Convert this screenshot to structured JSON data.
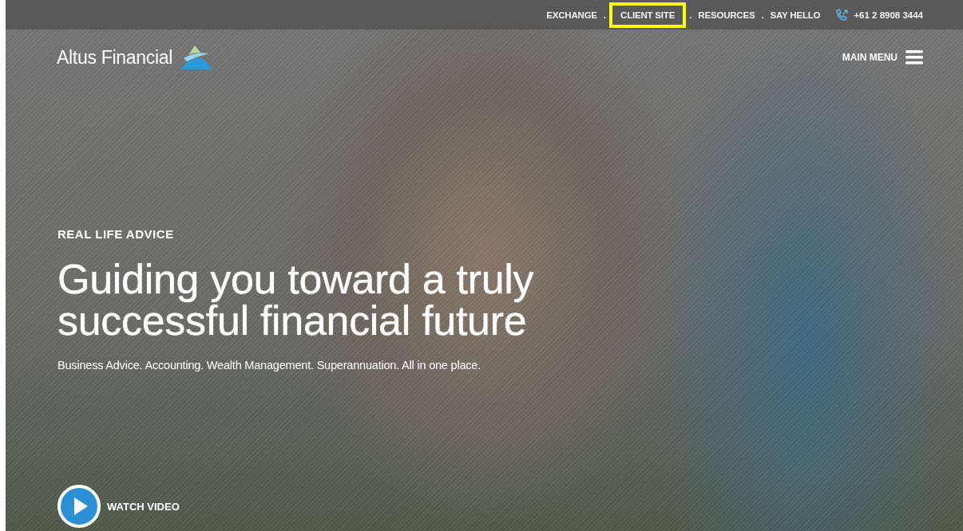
{
  "top_nav": {
    "items": [
      {
        "kind": "link",
        "label": "EXCHANGE",
        "highlighted": false
      },
      {
        "kind": "separator",
        "label": "."
      },
      {
        "kind": "link",
        "label": "CLIENT SITE",
        "highlighted": true
      },
      {
        "kind": "separator",
        "label": "."
      },
      {
        "kind": "link",
        "label": "RESOURCES",
        "highlighted": false
      },
      {
        "kind": "separator",
        "label": "."
      },
      {
        "kind": "link",
        "label": "SAY HELLO",
        "highlighted": false
      }
    ],
    "phone": "+61 2 8908 3444"
  },
  "header": {
    "logo_text": "Altus Financial",
    "menu_label": "MAIN MENU"
  },
  "hero": {
    "eyebrow": "REAL LIFE ADVICE",
    "headline_lines": [
      "Guiding you toward a truly",
      "successful financial future"
    ],
    "subtitle": "Business Advice. Accounting. Wealth Management. Superannuation. All in one place.",
    "video_label": "WATCH VIDEO"
  }
}
